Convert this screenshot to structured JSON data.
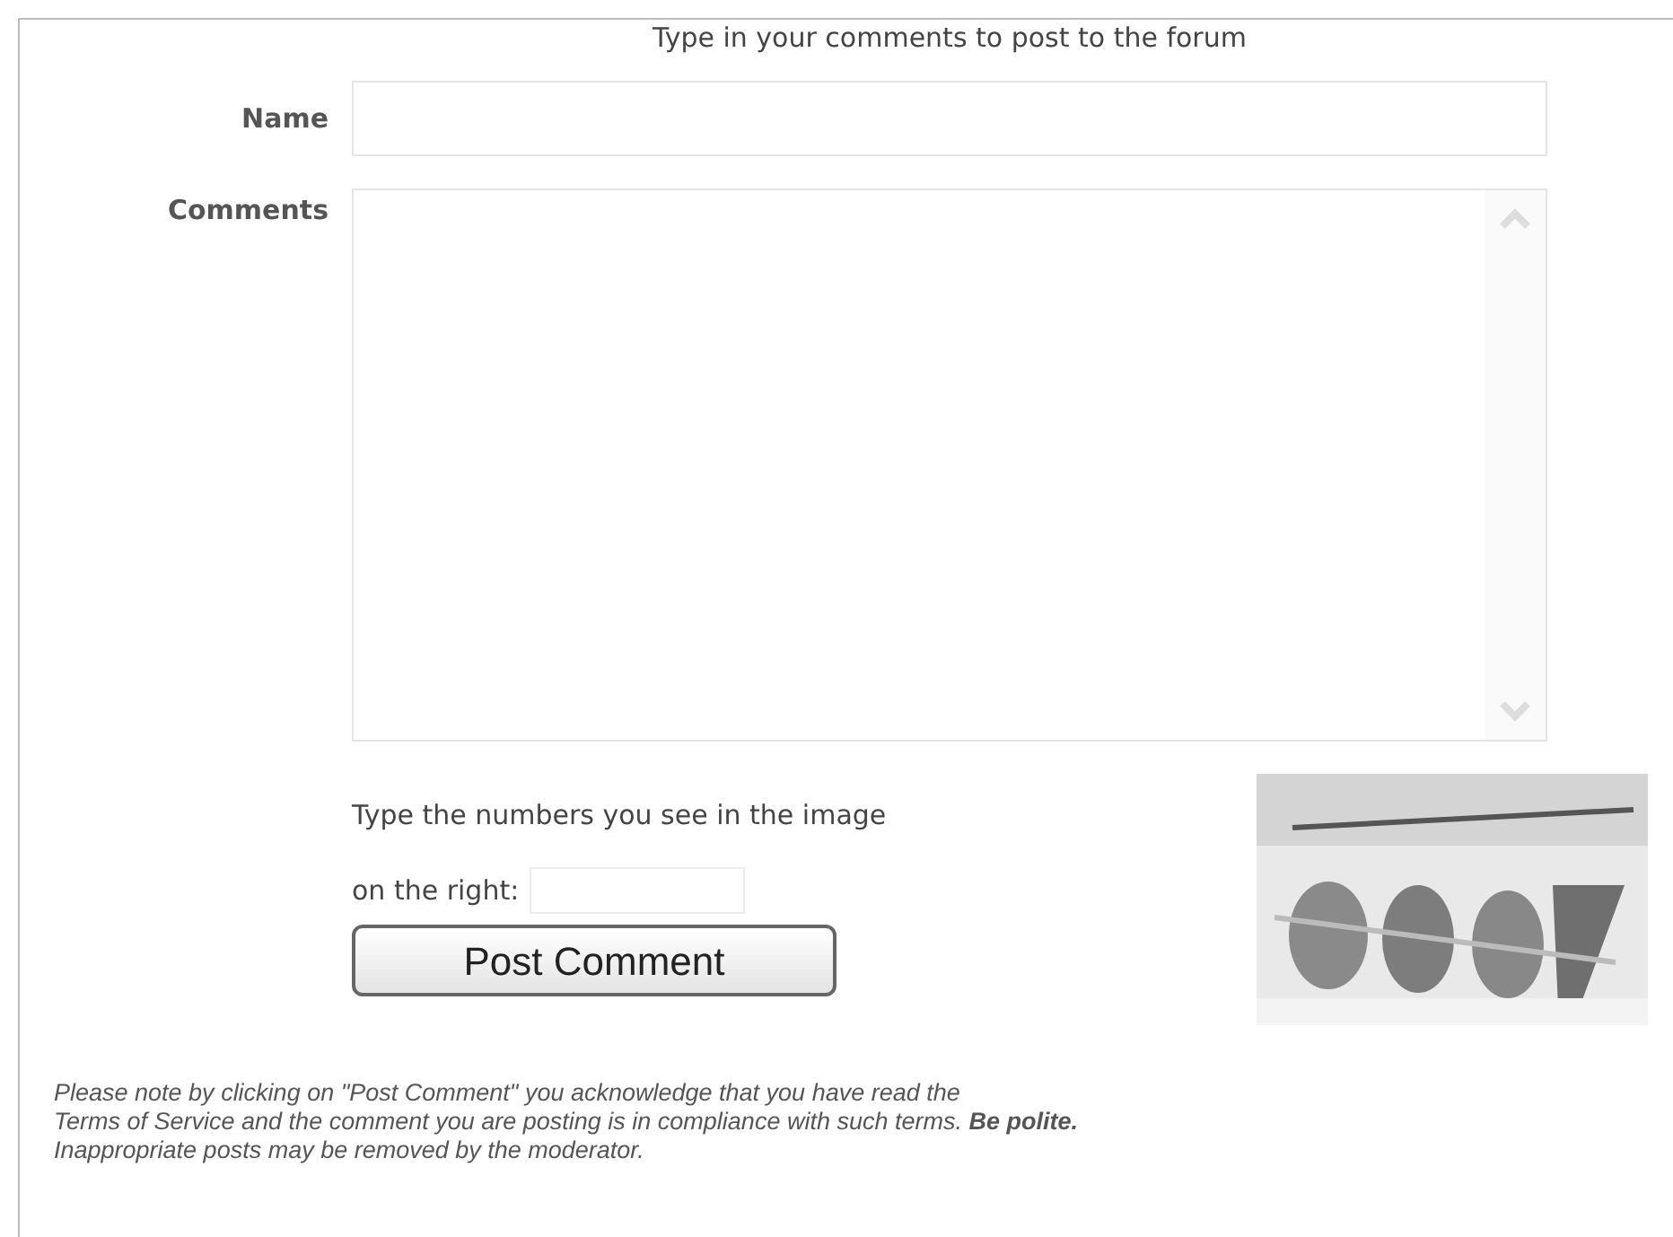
{
  "heading": "Type in your comments to post to the forum",
  "name_field": {
    "label": "Name"
  },
  "comments_field": {
    "label": "Comments"
  },
  "captcha": {
    "prompt_lines": [
      "Type the numbers you see in the image",
      "on the right:"
    ],
    "image": {
      "kind": "picture"
    }
  },
  "submit_button": "Post Comment",
  "note": {
    "lines": [
      "Please note by clicking on \"Post Comment\" you acknowledge that you have read the",
      "Terms of Service and the comment you are posting is in compliance with such terms. **Be polite.**",
      "Inappropriate posts may be removed by the moderator."
    ]
  }
}
